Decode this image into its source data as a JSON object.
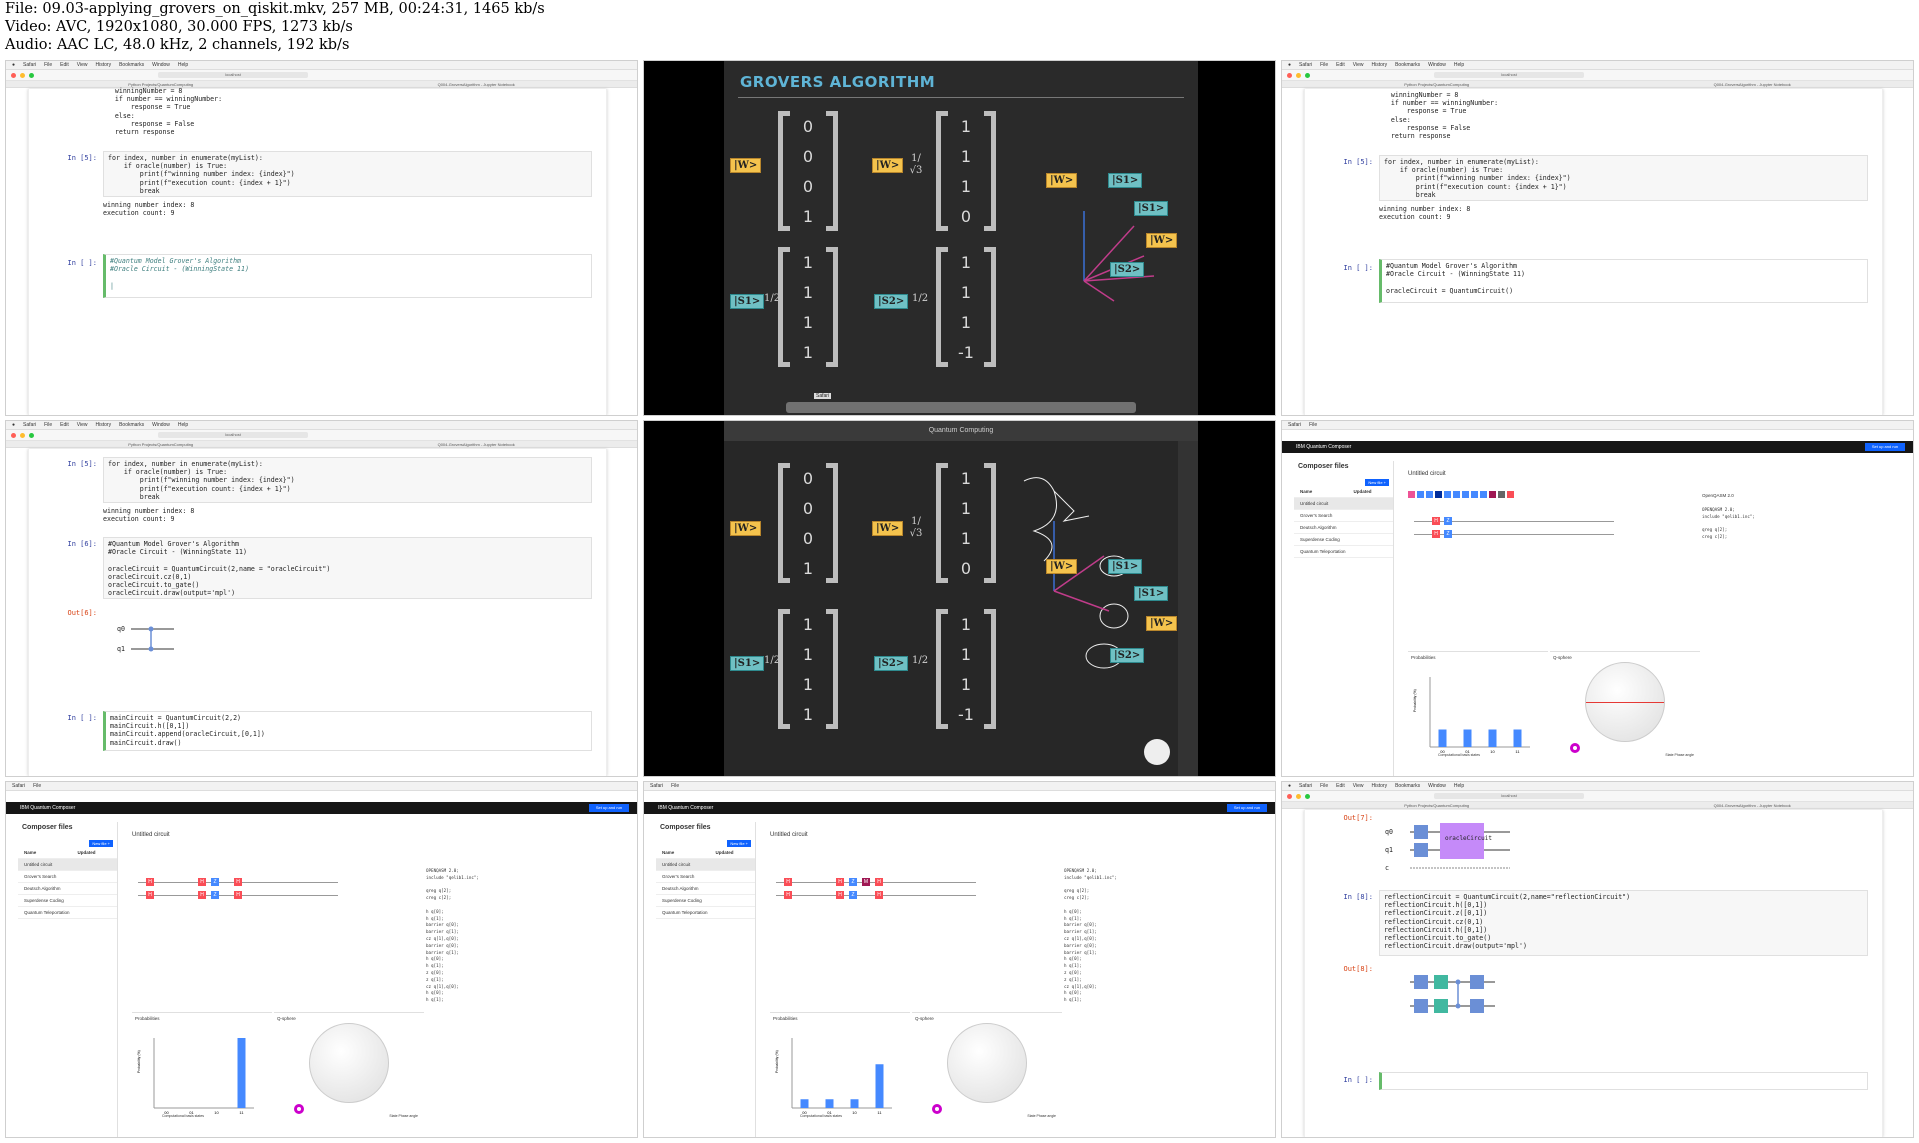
{
  "header": {
    "file": "File: 09.03-applying_grovers_on_qiskit.mkv, 257 MB, 00:24:31, 1465 kb/s",
    "video": "Video: AVC, 1920x1080, 30.000 FPS, 1273 kb/s",
    "audio": "Audio: AAC LC, 48.0 kHz, 2 channels, 192 kb/s"
  },
  "browser": {
    "menu": [
      "Safari",
      "File",
      "Edit",
      "View",
      "History",
      "Bookmarks",
      "Window",
      "Help"
    ],
    "address": "localhost",
    "tab_left": "Python Projects/QuantumComputing",
    "tab_right": "Q004-GroversAlgorithm - Jupyter Notebook"
  },
  "nb1": {
    "code_top": "    winningNumber = 8\n    if number == winningNumber:\n        response = True\n    else:\n        response = False\n    return response",
    "prompt5": "In [5]:",
    "cell5": "for index, number in enumerate(myList):\n    if oracle(number) is True:\n        print(f\"winning number index: {index}\")\n        print(f\"execution count: {index + 1}\")\n        break",
    "out5": "winning number index: 8\nexecution count: 9",
    "prompt_next": "In [ ]:",
    "cell_next": "#Quantum Model Grover's Algorithm\n#Oracle Circuit - (WinningState 11)\n\n|"
  },
  "nb3": {
    "cell_next": "#Quantum Model Grover's Algorithm\n#Oracle Circuit - (WinningState 11)\n\noracleCircuit = QuantumCircuit()"
  },
  "nb4": {
    "prompt6": "In [6]:",
    "cell6": "#Quantum Model Grover's Algorithm\n#Oracle Circuit - (WinningState 11)\n\noracleCircuit = QuantumCircuit(2,name = \"oracleCircuit\")\noracleCircuit.cz(0,1)\noracleCircuit.to_gate()\noracleCircuit.draw(output='mpl')",
    "out6": "Out[6]:",
    "q0": "q0",
    "q1": "q1",
    "prompt_next": "In [ ]:",
    "cell_next": "mainCircuit = QuantumCircuit(2,2)\nmainCircuit.h([0,1])\nmainCircuit.append(oracleCircuit,[0,1])\nmainCircuit.draw()"
  },
  "nb9": {
    "out7": "Out[7]:",
    "oracle_label": "oracleCircuit",
    "q0": "q0",
    "q1": "q1",
    "c": "c",
    "prompt8": "In [8]:",
    "cell8": "reflectionCircuit = QuantumCircuit(2,name=\"reflectionCircuit\")\nreflectionCircuit.h([0,1])\nreflectionCircuit.z([0,1])\nreflectionCircuit.cz(0,1)\nreflectionCircuit.h([0,1])\nreflectionCircuit.to_gate()\nreflectionCircuit.draw(output='mpl')",
    "out8": "Out[8]:",
    "prompt_next": "In [ ]:"
  },
  "slide": {
    "title": "GROVERS ALGORITHM",
    "ket_w": "|W>",
    "ket_s1": "|S1>",
    "ket_s2": "|S2>",
    "frac_w": "1/√3",
    "frac_half": "1/2",
    "v1": [
      "0",
      "0",
      "0",
      "1"
    ],
    "v2": [
      "1",
      "1",
      "1",
      "0"
    ],
    "v3": [
      "1",
      "1",
      "1",
      "1"
    ],
    "v4": [
      "1",
      "1",
      "1",
      "-1"
    ],
    "app_title": "Quantum Computing",
    "dock_tooltip": "Safari"
  },
  "composer": {
    "brand": "IBM Quantum Composer",
    "files_title": "Composer files",
    "new_file": "New file +",
    "setup": "Set up and run",
    "circuit_title": "Untitled circuit",
    "files": [
      "Untitled circuit",
      "Grover's Search",
      "Deutsch Algorithm",
      "Superdense Coding",
      "Quantum Teleportation"
    ],
    "updated": [
      "a few seconds ago",
      "2 days ago",
      "2 hours ago",
      "3 days ago",
      "4 days ago"
    ],
    "col_name": "Name",
    "col_updated": "Updated",
    "menus": [
      "File",
      "Edit",
      "Inspect",
      "View",
      "Share"
    ],
    "qasm_head": "OpenQASM 2.0",
    "qasm_initial": "OPENQASM 2.0;\ninclude \"qelib1.inc\";\n\nqreg q[2];\ncreg c[2];",
    "qasm_full": "OPENQASM 2.0;\ninclude \"qelib1.inc\";\n\nqreg q[2];\ncreg c[2];\n\nh q[0];\nh q[1];\nbarrier q[0];\nbarrier q[1];\ncz q[1],q[0];\nbarrier q[0];\nbarrier q[1];\nh q[0];\nh q[1];\nz q[0];\nz q[1];\ncz q[1],q[0];\nh q[0];\nh q[1];",
    "prob_label": "Probabilities",
    "qsphere_label": "Q-sphere",
    "xaxis": "Computational basis states",
    "yaxis": "Probability (%)",
    "states": [
      "00",
      "01",
      "10",
      "11"
    ],
    "legend_state": "State",
    "legend_phase": "Phase angle"
  },
  "chart_data": [
    {
      "type": "bar",
      "title": "Probabilities",
      "xlabel": "Computational basis states",
      "ylabel": "Probability (%)",
      "categories": [
        "00",
        "01",
        "10",
        "11"
      ],
      "values": [
        25,
        25,
        25,
        25
      ],
      "ylim": [
        0,
        100
      ]
    },
    {
      "type": "bar",
      "title": "Probabilities",
      "xlabel": "Computational basis states",
      "ylabel": "Probability (%)",
      "categories": [
        "00",
        "01",
        "10",
        "11"
      ],
      "values": [
        0,
        0,
        0,
        100
      ],
      "ylim": [
        0,
        100
      ]
    },
    {
      "type": "bar",
      "title": "Probabilities",
      "xlabel": "Computational basis states",
      "ylabel": "Probability (%)",
      "categories": [
        "00",
        "01",
        "10",
        "11"
      ],
      "values": [
        12.5,
        12.5,
        12.5,
        62.5
      ],
      "ylim": [
        0,
        100
      ]
    }
  ]
}
